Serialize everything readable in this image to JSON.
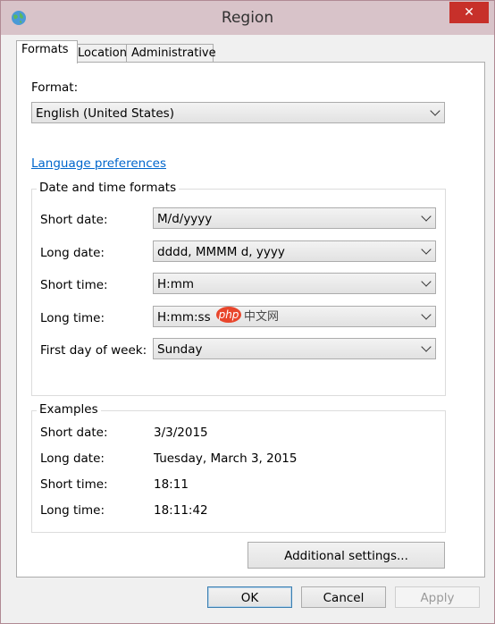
{
  "window": {
    "title": "Region",
    "close_label": "✕"
  },
  "tabs": [
    {
      "label": "Formats",
      "active": true
    },
    {
      "label": "Location",
      "active": false
    },
    {
      "label": "Administrative",
      "active": false
    }
  ],
  "format": {
    "label": "Format:",
    "value": "English (United States)"
  },
  "language_link": "Language preferences",
  "date_time_formats": {
    "title": "Date and time formats",
    "short_date": {
      "label": "Short date:",
      "value": "M/d/yyyy"
    },
    "long_date": {
      "label": "Long date:",
      "value": "dddd, MMMM d, yyyy"
    },
    "short_time": {
      "label": "Short time:",
      "value": "H:mm"
    },
    "long_time": {
      "label": "Long time:",
      "value": "H:mm:ss"
    },
    "first_day": {
      "label": "First day of week:",
      "value": "Sunday"
    }
  },
  "examples": {
    "title": "Examples",
    "short_date": {
      "label": "Short date:",
      "value": "3/3/2015"
    },
    "long_date": {
      "label": "Long date:",
      "value": "Tuesday, March 3, 2015"
    },
    "short_time": {
      "label": "Short time:",
      "value": "18:11"
    },
    "long_time": {
      "label": "Long time:",
      "value": "18:11:42"
    }
  },
  "additional_settings": "Additional settings...",
  "buttons": {
    "ok": "OK",
    "cancel": "Cancel",
    "apply": "Apply"
  },
  "watermark": {
    "logo": "php",
    "text": "中文网"
  }
}
